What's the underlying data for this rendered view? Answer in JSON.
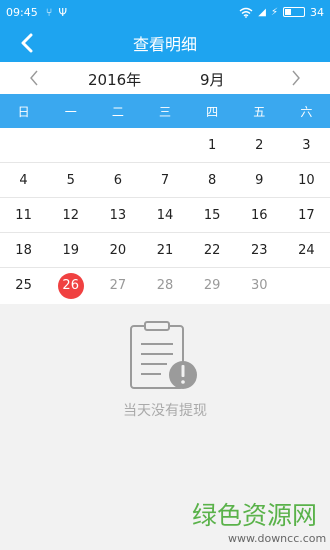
{
  "status_bar": {
    "time": "09:45",
    "battery_level": "34",
    "battery_fraction": 0.34
  },
  "header": {
    "title": "查看明细"
  },
  "month_nav": {
    "year": "2016年",
    "month": "9月"
  },
  "weekdays": [
    "日",
    "一",
    "二",
    "三",
    "四",
    "五",
    "六"
  ],
  "calendar": {
    "weeks": [
      [
        "",
        "",
        "",
        "",
        "1",
        "2",
        "3"
      ],
      [
        "4",
        "5",
        "6",
        "7",
        "8",
        "9",
        "10"
      ],
      [
        "11",
        "12",
        "13",
        "14",
        "15",
        "16",
        "17"
      ],
      [
        "18",
        "19",
        "20",
        "21",
        "22",
        "23",
        "24"
      ],
      [
        "25",
        "26",
        "27",
        "28",
        "29",
        "30",
        ""
      ]
    ],
    "selected_day": "26",
    "future_days": [
      "27",
      "28",
      "29",
      "30"
    ]
  },
  "empty_state": {
    "message": "当天没有提现"
  },
  "watermark": {
    "brand": "绿色资源网",
    "url": "www.downcc.com"
  },
  "colors": {
    "primary": "#1ea4f0",
    "weekday_bar": "#3aa8ef",
    "selected": "#f04141",
    "watermark_green": "#5ab24a"
  }
}
